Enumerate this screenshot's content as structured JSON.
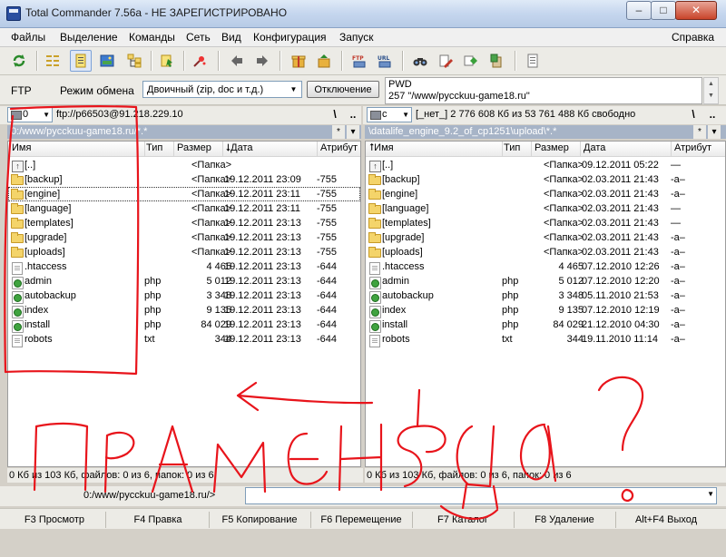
{
  "window": {
    "title": "Total Commander 7.56a - НЕ ЗАРЕГИСТРИРОВАНО",
    "min_symbol": "–",
    "max_symbol": "□",
    "close_symbol": "✕"
  },
  "menu": {
    "files": "Файлы",
    "selection": "Выделение",
    "commands": "Команды",
    "network": "Сеть",
    "view": "Вид",
    "config": "Конфигурация",
    "launch": "Запуск",
    "help": "Справка"
  },
  "toolbar": {
    "icons": [
      "refresh-icon",
      "brief-view-icon",
      "detailed-view-icon",
      "thumbnails-icon",
      "tree-icon",
      "invert-selection-icon",
      "select-icon",
      "back-icon",
      "forward-icon",
      "pack-icon",
      "unpack-icon",
      "ftp-connect-icon",
      "url-connect-icon",
      "find-icon",
      "rename-icon",
      "sync-icon",
      "notepad-icon"
    ]
  },
  "ftp_bar": {
    "label": "FTP",
    "mode_label": "Режим обмена",
    "mode_value": "Двоичный (zip, doc и т.д.)",
    "disconnect": "Отключение",
    "log_line1": "PWD",
    "log_line2": "257 \"/www/pycckuu-game18.ru\""
  },
  "left_panel": {
    "drive": "0",
    "drive_info": "ftp://p66503@91.218.229.10",
    "root_btn": "\\",
    "up_btn": "..",
    "path": "0:/www/pycckuu-game18.ru/*.*",
    "path_filter_btn": "*",
    "path_arrow_btn": "▾",
    "columns": {
      "name": "Имя",
      "ext": "Тип",
      "size": "Размер",
      "date": "Дата",
      "attr": "Атрибут"
    },
    "rows": [
      {
        "name": "[..]",
        "ext": "",
        "size": "<Папка>",
        "date": "",
        "attr": "",
        "icon": "up"
      },
      {
        "name": "[backup]",
        "ext": "",
        "size": "<Папка>",
        "date": "19.12.2011 23:09",
        "attr": "-755",
        "icon": "folder"
      },
      {
        "name": "[engine]",
        "ext": "",
        "size": "<Папка>",
        "date": "19.12.2011 23:11",
        "attr": "-755",
        "icon": "folder"
      },
      {
        "name": "[language]",
        "ext": "",
        "size": "<Папка>",
        "date": "19.12.2011 23:11",
        "attr": "-755",
        "icon": "folder"
      },
      {
        "name": "[templates]",
        "ext": "",
        "size": "<Папка>",
        "date": "19.12.2011 23:13",
        "attr": "-755",
        "icon": "folder"
      },
      {
        "name": "[upgrade]",
        "ext": "",
        "size": "<Папка>",
        "date": "19.12.2011 23:13",
        "attr": "-755",
        "icon": "folder"
      },
      {
        "name": "[uploads]",
        "ext": "",
        "size": "<Папка>",
        "date": "19.12.2011 23:13",
        "attr": "-755",
        "icon": "folder"
      },
      {
        "name": ".htaccess",
        "ext": "",
        "size": "4 465",
        "date": "19.12.2011 23:13",
        "attr": "-644",
        "icon": "file"
      },
      {
        "name": "admin",
        "ext": "php",
        "size": "5 012",
        "date": "19.12.2011 23:13",
        "attr": "-644",
        "icon": "php"
      },
      {
        "name": "autobackup",
        "ext": "php",
        "size": "3 348",
        "date": "19.12.2011 23:13",
        "attr": "-644",
        "icon": "php"
      },
      {
        "name": "index",
        "ext": "php",
        "size": "9 135",
        "date": "19.12.2011 23:13",
        "attr": "-644",
        "icon": "php"
      },
      {
        "name": "install",
        "ext": "php",
        "size": "84 029",
        "date": "19.12.2011 23:13",
        "attr": "-644",
        "icon": "php"
      },
      {
        "name": "robots",
        "ext": "txt",
        "size": "344",
        "date": "19.12.2011 23:13",
        "attr": "-644",
        "icon": "file"
      }
    ],
    "status": "0 Кб из 103 Кб, файлов: 0 из 6, папок: 0 из 6"
  },
  "right_panel": {
    "drive": "c",
    "drive_info": "[_нет_]  2 776 608 Кб из 53 761 488 Кб свободно",
    "root_btn": "\\",
    "up_btn": "..",
    "path": "\\datalife_engine_9.2_of_cp1251\\upload\\*.*",
    "path_filter_btn": "*",
    "path_arrow_btn": "▾",
    "columns": {
      "name": "Имя",
      "ext": "Тип",
      "size": "Размер",
      "date": "Дата",
      "attr": "Атрибут"
    },
    "rows": [
      {
        "name": "[..]",
        "ext": "",
        "size": "<Папка>",
        "date": "09.12.2011 05:22",
        "attr": "—",
        "icon": "up"
      },
      {
        "name": "[backup]",
        "ext": "",
        "size": "<Папка>",
        "date": "02.03.2011 21:43",
        "attr": "-a–",
        "icon": "folder"
      },
      {
        "name": "[engine]",
        "ext": "",
        "size": "<Папка>",
        "date": "02.03.2011 21:43",
        "attr": "-a–",
        "icon": "folder"
      },
      {
        "name": "[language]",
        "ext": "",
        "size": "<Папка>",
        "date": "02.03.2011 21:43",
        "attr": "—",
        "icon": "folder"
      },
      {
        "name": "[templates]",
        "ext": "",
        "size": "<Папка>",
        "date": "02.03.2011 21:43",
        "attr": "—",
        "icon": "folder"
      },
      {
        "name": "[upgrade]",
        "ext": "",
        "size": "<Папка>",
        "date": "02.03.2011 21:43",
        "attr": "-a–",
        "icon": "folder"
      },
      {
        "name": "[uploads]",
        "ext": "",
        "size": "<Папка>",
        "date": "02.03.2011 21:43",
        "attr": "-a–",
        "icon": "folder"
      },
      {
        "name": ".htaccess",
        "ext": "",
        "size": "4 465",
        "date": "07.12.2010 12:26",
        "attr": "-a–",
        "icon": "file"
      },
      {
        "name": "admin",
        "ext": "php",
        "size": "5 012",
        "date": "07.12.2010 12:20",
        "attr": "-a–",
        "icon": "php"
      },
      {
        "name": "autobackup",
        "ext": "php",
        "size": "3 348",
        "date": "05.11.2010 21:53",
        "attr": "-a–",
        "icon": "php"
      },
      {
        "name": "index",
        "ext": "php",
        "size": "9 135",
        "date": "07.12.2010 12:19",
        "attr": "-a–",
        "icon": "php"
      },
      {
        "name": "install",
        "ext": "php",
        "size": "84 029",
        "date": "21.12.2010 04:30",
        "attr": "-a–",
        "icon": "php"
      },
      {
        "name": "robots",
        "ext": "txt",
        "size": "344",
        "date": "19.11.2010 11:14",
        "attr": "-a–",
        "icon": "file"
      }
    ],
    "status": "0 Кб из 103 Кб, файлов: 0 из 6, папок: 0 из 6"
  },
  "command_line": {
    "path": "0:/www/pycckuu-game18.ru/>"
  },
  "function_keys": {
    "f3": "F3 Просмотр",
    "f4": "F4 Правка",
    "f5": "F5 Копирование",
    "f6": "F6 Перемещение",
    "f7": "F7 Каталог",
    "f8": "F8 Удаление",
    "altf4": "Alt+F4 Выход"
  },
  "colors": {
    "scribble": "#e8141b",
    "path_bar": "#a7b4c7",
    "window_bg": "#ecebe6"
  }
}
